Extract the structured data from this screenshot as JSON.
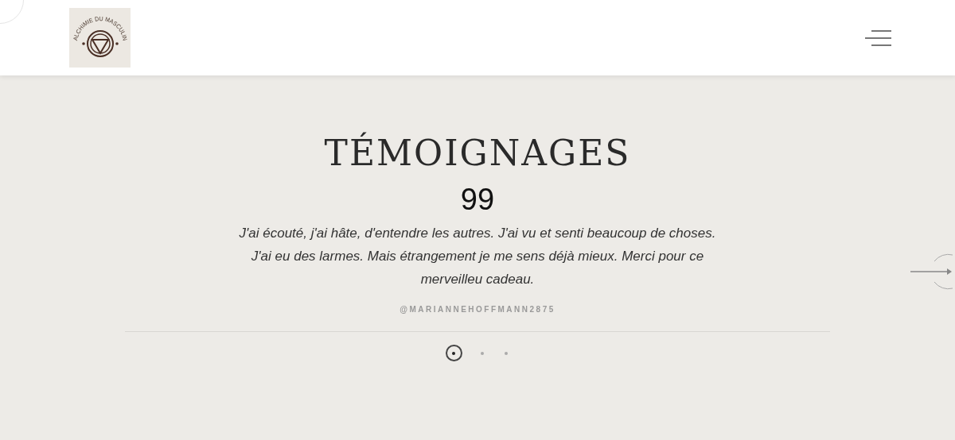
{
  "header": {
    "logo_text": "ALCHIMIE DU MASCULIN"
  },
  "testimonials": {
    "title": "TÉMOIGNAGES",
    "quote_mark": "99",
    "quote": "J'ai écouté, j'ai hâte, d'entendre les autres. J'ai vu et senti beaucoup de choses. J'ai eu des larmes. Mais étrangement je me sens déjà mieux. Merci pour ce merveilleu cadeau.",
    "author": "@MARIANNEHOFFMANN2875",
    "dots": [
      {
        "selected": true
      },
      {
        "selected": false
      },
      {
        "selected": false
      }
    ]
  }
}
